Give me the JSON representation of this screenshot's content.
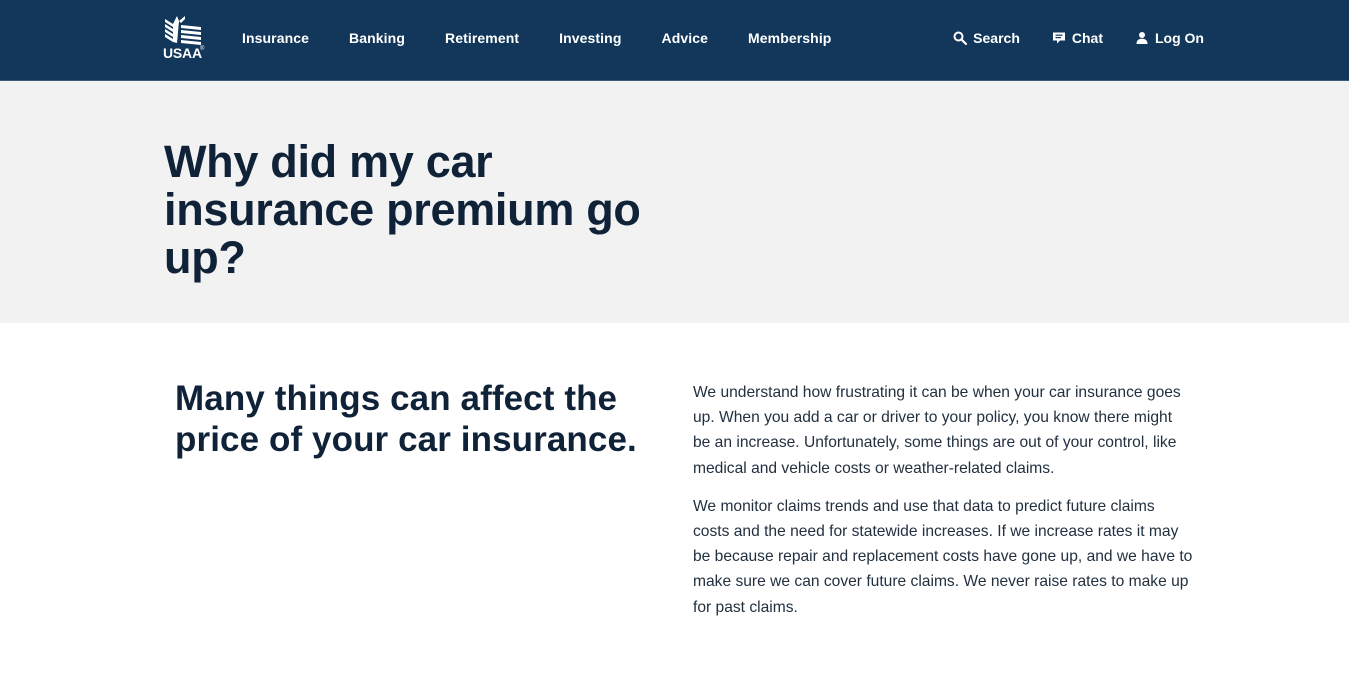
{
  "header": {
    "logo_text": "USAA",
    "logo_reg": "®",
    "nav": [
      {
        "label": "Insurance"
      },
      {
        "label": "Banking"
      },
      {
        "label": "Retirement"
      },
      {
        "label": "Investing"
      },
      {
        "label": "Advice"
      },
      {
        "label": "Membership"
      }
    ],
    "utility": {
      "search": {
        "label": "Search",
        "icon": "search-icon"
      },
      "chat": {
        "label": "Chat",
        "icon": "chat-icon"
      },
      "login": {
        "label": "Log On",
        "icon": "user-icon"
      }
    },
    "colors": {
      "background": "#12375b",
      "text": "#ffffff"
    }
  },
  "hero": {
    "title": "Why did my car insurance premium go up?",
    "background": "#f2f2f2"
  },
  "content": {
    "heading": "Many things can affect the price of your car insurance.",
    "paragraphs": [
      "We understand how frustrating it can be when your car insurance goes up. When you add a car or driver to your policy, you know there might be an increase. Unfortunately, some things are out of your control, like medical and vehicle costs or weather-related claims.",
      "We monitor claims trends and use that data to predict future claims costs and the need for statewide increases. If we increase rates it may be because repair and replacement costs have gone up, and we have to make sure we can cover future claims. We never raise rates to make up for past claims."
    ]
  }
}
